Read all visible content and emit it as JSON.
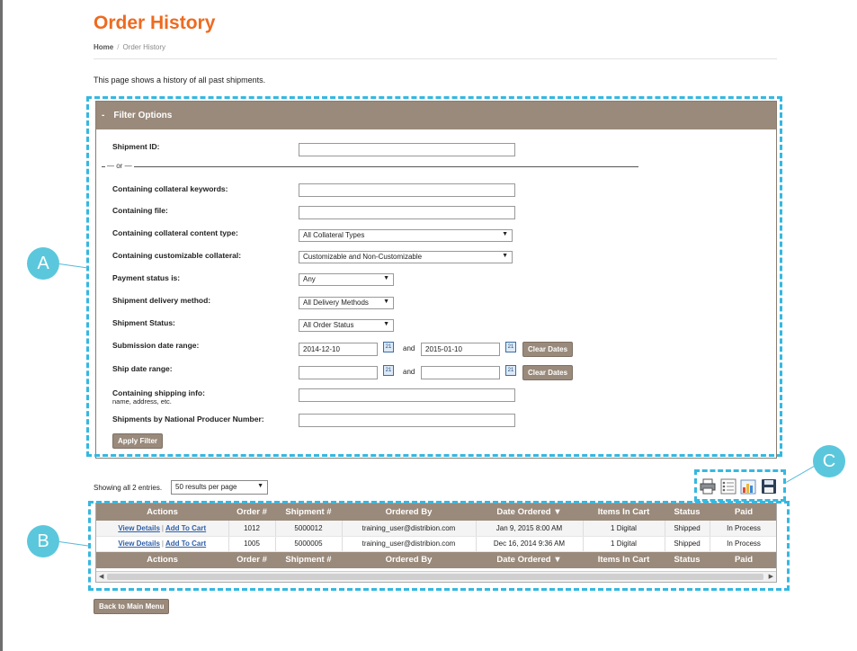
{
  "page": {
    "title": "Order History",
    "breadcrumb": {
      "home": "Home",
      "separator": "/",
      "current": "Order History"
    },
    "intro": "This page shows a history of all past shipments."
  },
  "filter": {
    "header_toggle": "-",
    "header_title": "Filter Options",
    "shipment_id_label": "Shipment ID:",
    "or_text": "or",
    "keywords_label": "Containing collateral keywords:",
    "file_label": "Containing file:",
    "content_type_label": "Containing collateral content type:",
    "content_type_value": "All Collateral Types",
    "customizable_label": "Containing customizable collateral:",
    "customizable_value": "Customizable and Non-Customizable",
    "payment_label": "Payment status is:",
    "payment_value": "Any",
    "delivery_label": "Shipment delivery method:",
    "delivery_value": "All Delivery Methods",
    "status_label": "Shipment Status:",
    "status_value": "All Order Status",
    "submission_label": "Submission date range:",
    "submission_from": "2014-12-10",
    "submission_to": "2015-01-10",
    "ship_label": "Ship date range:",
    "ship_from": "",
    "ship_to": "",
    "and_text": "and",
    "clear_dates": "Clear Dates",
    "shipping_info_label": "Containing shipping info:",
    "shipping_info_sub": "name, address, etc.",
    "npn_label": "Shipments by National Producer Number:",
    "apply_button": "Apply Filter",
    "calendar_glyph": "21"
  },
  "results": {
    "showing_text": "Showing all 2 entries.",
    "per_page": "50 results per page",
    "tools": [
      "printer-icon",
      "column-list-icon",
      "chart-export-icon",
      "save-disk-icon"
    ],
    "columns": [
      "Actions",
      "Order #",
      "Shipment #",
      "Ordered By",
      "Date Ordered ▼",
      "Items In Cart",
      "Status",
      "Paid"
    ],
    "rows": [
      {
        "view": "View Details",
        "add": "Add To Cart",
        "order": "1012",
        "shipment": "5000012",
        "by": "training_user@distribion.com",
        "date": "Jan 9, 2015 8:00 AM",
        "items": "1 Digital",
        "status": "Shipped",
        "paid": "In Process"
      },
      {
        "view": "View Details",
        "add": "Add To Cart",
        "order": "1005",
        "shipment": "5000005",
        "by": "training_user@distribion.com",
        "date": "Dec 16, 2014 9:36 AM",
        "items": "1 Digital",
        "status": "Shipped",
        "paid": "In Process"
      }
    ],
    "action_separator": "|"
  },
  "back_button": "Back to Main Menu",
  "callouts": {
    "a": "A",
    "b": "B",
    "c": "C"
  },
  "colors": {
    "brand_orange": "#ee6a1f",
    "header_brown": "#9a8a7b",
    "callout_blue": "#5bc7dc",
    "dash_blue": "#35b8e0",
    "link_blue": "#2f5fa8"
  }
}
